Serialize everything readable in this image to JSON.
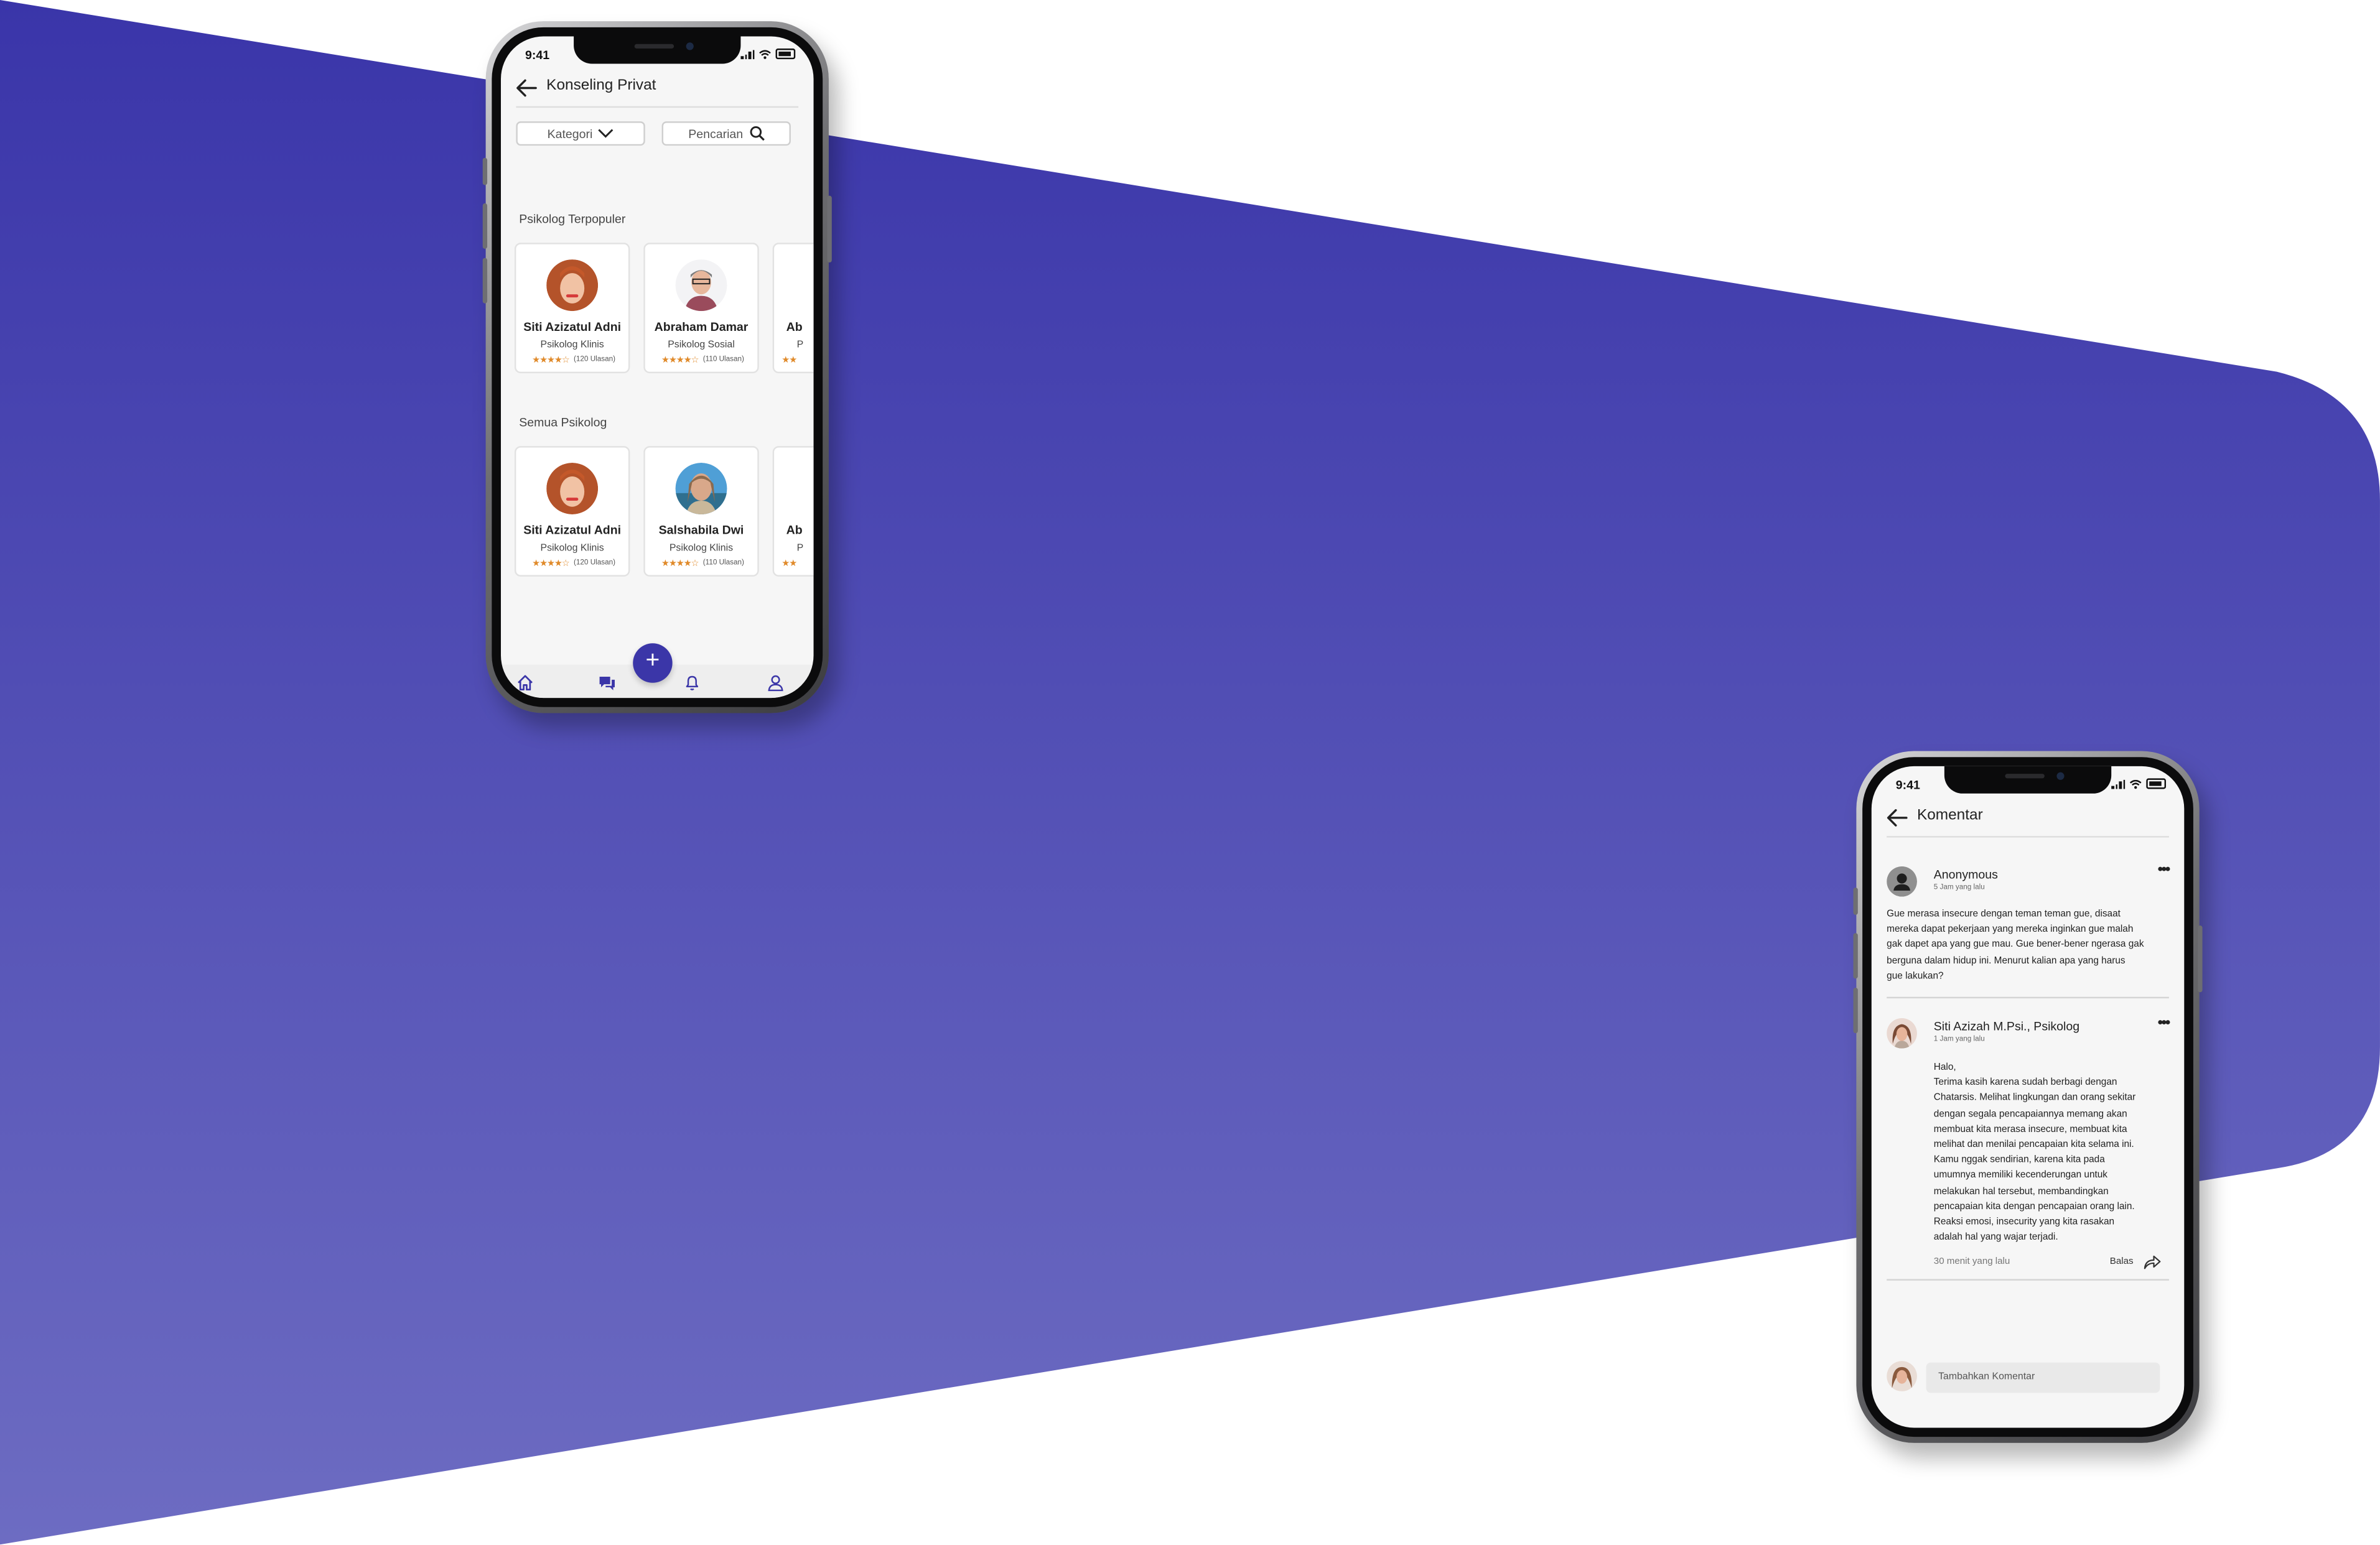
{
  "colors": {
    "brand": "#3b36a8",
    "band_top": "#3a35a9",
    "band_bottom": "#6d6cc2",
    "star": "#e08a2a"
  },
  "phone1": {
    "status_time": "9:41",
    "title": "Konseling Privat",
    "filters": {
      "category_label": "Kategori",
      "search_label": "Pencarian"
    },
    "popular": {
      "title": "Psikolog Terpopuler",
      "cards": [
        {
          "name": "Siti Azizatul Adni",
          "role": "Psikolog Klinis",
          "stars": "★★★★☆",
          "reviews": "(120 Ulasan)"
        },
        {
          "name": "Abraham Damar",
          "role": "Psikolog Sosial",
          "stars": "★★★★☆",
          "reviews": "(110 Ulasan)"
        },
        {
          "name": "Ab",
          "role": "P",
          "stars": "★★",
          "reviews": ""
        }
      ]
    },
    "all": {
      "title": "Semua Psikolog",
      "cards": [
        {
          "name": "Siti Azizatul Adni",
          "role": "Psikolog Klinis",
          "stars": "★★★★☆",
          "reviews": "(120 Ulasan)"
        },
        {
          "name": "Salshabila Dwi",
          "role": "Psikolog Klinis",
          "stars": "★★★★☆",
          "reviews": "(110 Ulasan)"
        },
        {
          "name": "Ab",
          "role": "P",
          "stars": "★★",
          "reviews": ""
        }
      ]
    },
    "nav": {
      "fab_label": "+",
      "icons": [
        "home-icon",
        "chat-icon",
        "bell-icon",
        "profile-icon"
      ]
    }
  },
  "phone2": {
    "status_time": "9:41",
    "title": "Komentar",
    "post": {
      "author": "Anonymous",
      "time": "5 Jam yang lalu",
      "body": "Gue merasa insecure dengan teman teman gue, disaat\nmereka dapat pekerjaan yang mereka inginkan gue malah\ngak dapet apa yang gue mau. Gue bener-bener ngerasa gak\nberguna dalam hidup ini. Menurut kalian apa yang harus\ngue lakukan?"
    },
    "reply": {
      "author": "Siti Azizah M.Psi., Psikolog",
      "time": "1 Jam yang lalu",
      "body": "Halo,\nTerima kasih karena sudah berbagi dengan\nChatarsis. Melihat lingkungan dan orang sekitar\ndengan segala pencapaiannya memang akan\nmembuat kita merasa insecure, membuat kita\nmelihat dan menilai pencapaian kita selama ini.\nKamu nggak sendirian, karena kita pada\numumnya memiliki kecenderungan untuk\nmelakukan hal tersebut, membandingkan\npencapaian kita dengan pencapaian orang lain.\nReaksi emosi, insecurity yang kita rasakan\nadalah hal yang wajar terjadi.",
      "footer_time": "30 menit yang lalu",
      "reply_label": "Balas"
    },
    "comment_input_placeholder": "Tambahkan Komentar"
  }
}
